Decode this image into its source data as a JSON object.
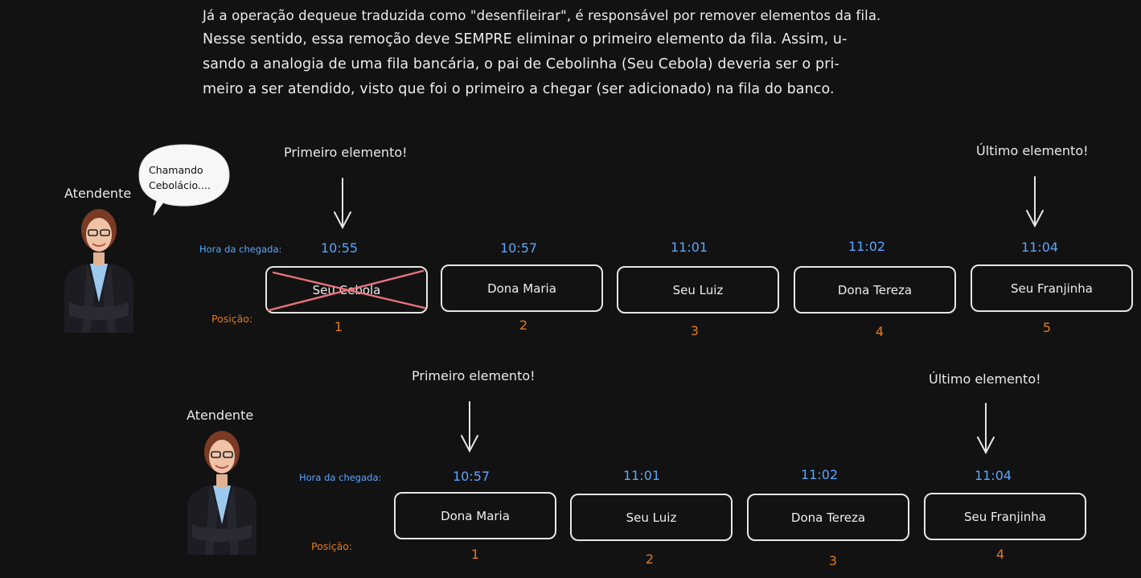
{
  "intro": {
    "line1": "Já a operação dequeue traduzida como \"desenfileirar\", é responsável por remover elementos da fila.",
    "line2": "Nesse sentido, essa remoção deve SEMPRE eliminar o primeiro elemento da fila. Assim, u-",
    "line3": "sando a analogia de uma fila bancária, o pai de Cebolinha (Seu Cebola) deveria ser o pri-",
    "line4": "meiro a ser atendido, visto que foi o primeiro a chegar (ser adicionado) na fila do banco."
  },
  "labels": {
    "first": "Primeiro elemento!",
    "last": "Último elemento!",
    "attendant": "Atendente",
    "arrival": "Hora da chegada:",
    "position": "Posição:"
  },
  "bubble": {
    "line1": "Chamando",
    "line2": "Cebolácio...."
  },
  "queue_before": [
    {
      "name": "Seu Cebola",
      "time": "10:55",
      "position": "1",
      "removed": true
    },
    {
      "name": "Dona Maria",
      "time": "10:57",
      "position": "2"
    },
    {
      "name": "Seu Luiz",
      "time": "11:01",
      "position": "3"
    },
    {
      "name": "Dona Tereza",
      "time": "11:02",
      "position": "4"
    },
    {
      "name": "Seu Franjinha",
      "time": "11:04",
      "position": "5"
    }
  ],
  "queue_after": [
    {
      "name": "Dona Maria",
      "time": "10:57",
      "position": "1"
    },
    {
      "name": "Seu Luiz",
      "time": "11:01",
      "position": "2"
    },
    {
      "name": "Dona Tereza",
      "time": "11:02",
      "position": "3"
    },
    {
      "name": "Seu Franjinha",
      "time": "11:04",
      "position": "4"
    }
  ],
  "colors": {
    "background": "#121212",
    "time": "#5aa6ff",
    "position": "#e07a1f",
    "strike": "#e8737b"
  }
}
